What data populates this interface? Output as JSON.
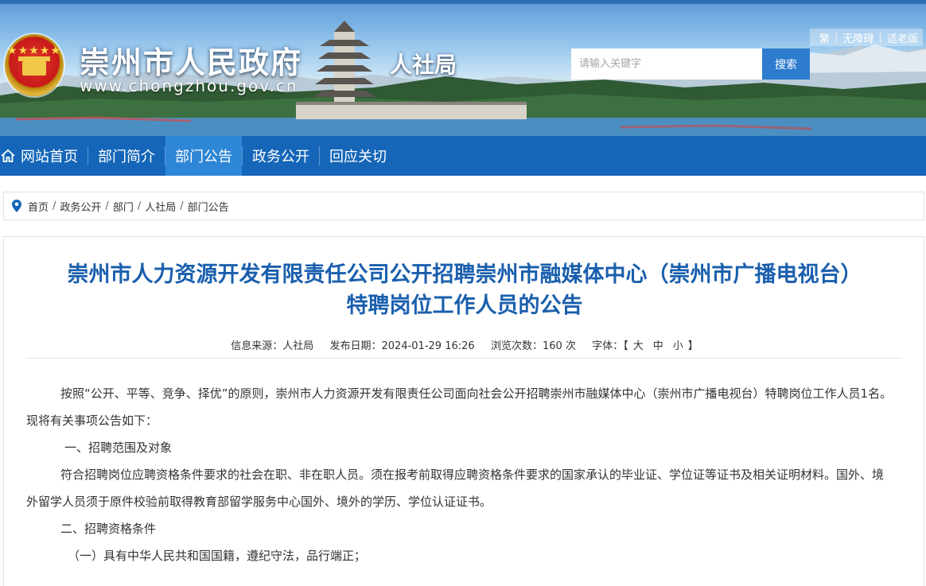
{
  "header": {
    "site_title": "崇州市人民政府",
    "site_url": "www.chongzhou.gov.cn",
    "department": "人社局",
    "utility_links": [
      "繁",
      "无障碍",
      "适老版"
    ],
    "search_placeholder": "请输入关键字",
    "search_button": "搜索"
  },
  "nav": {
    "items": [
      {
        "label": "网站首页",
        "icon": "home-icon"
      },
      {
        "label": "部门简介"
      },
      {
        "label": "部门公告",
        "active": true
      },
      {
        "label": "政务公开"
      },
      {
        "label": "回应关切"
      }
    ]
  },
  "breadcrumb": [
    "首页",
    "政务公开",
    "部门",
    "人社局",
    "部门公告"
  ],
  "article": {
    "title_line1": "崇州市人力资源开发有限责任公司公开招聘崇州市融媒体中心（崇州市广播电视台）",
    "title_line2": "特聘岗位工作人员的公告",
    "meta": {
      "source_label": "信息来源：",
      "source": "人社局",
      "date_label": "发布日期：",
      "date": "2024-01-29 16:26",
      "views_label": "浏览次数：",
      "views": "160 次",
      "font_label": "字体：",
      "bracket_open": "【",
      "font_large": "大",
      "font_medium": "中",
      "font_small": "小",
      "bracket_close": "】"
    },
    "paragraphs": [
      "按照“公开、平等、竞争、择优”的原则，崇州市人力资源开发有限责任公司面向社会公开招聘崇州市融媒体中心（崇州市广播电视台）特聘岗位工作人员1名。现将有关事项公告如下：",
      "一、招聘范围及对象",
      "符合招聘岗位应聘资格条件要求的社会在职、非在职人员。须在报考前取得应聘资格条件要求的国家承认的毕业证、学位证等证书及相关证明材料。国外、境外留学人员须于原件校验前取得教育部留学服务中心国外、境外的学历、学位认证证书。",
      "二、招聘资格条件",
      "（一）具有中华人民共和国国籍，遵纪守法，品行端正；"
    ]
  },
  "colors": {
    "nav_bg": "#1566b8",
    "nav_active": "#2e86d6",
    "title_blue": "#1a5fad",
    "search_btn": "#2e7ccf"
  }
}
